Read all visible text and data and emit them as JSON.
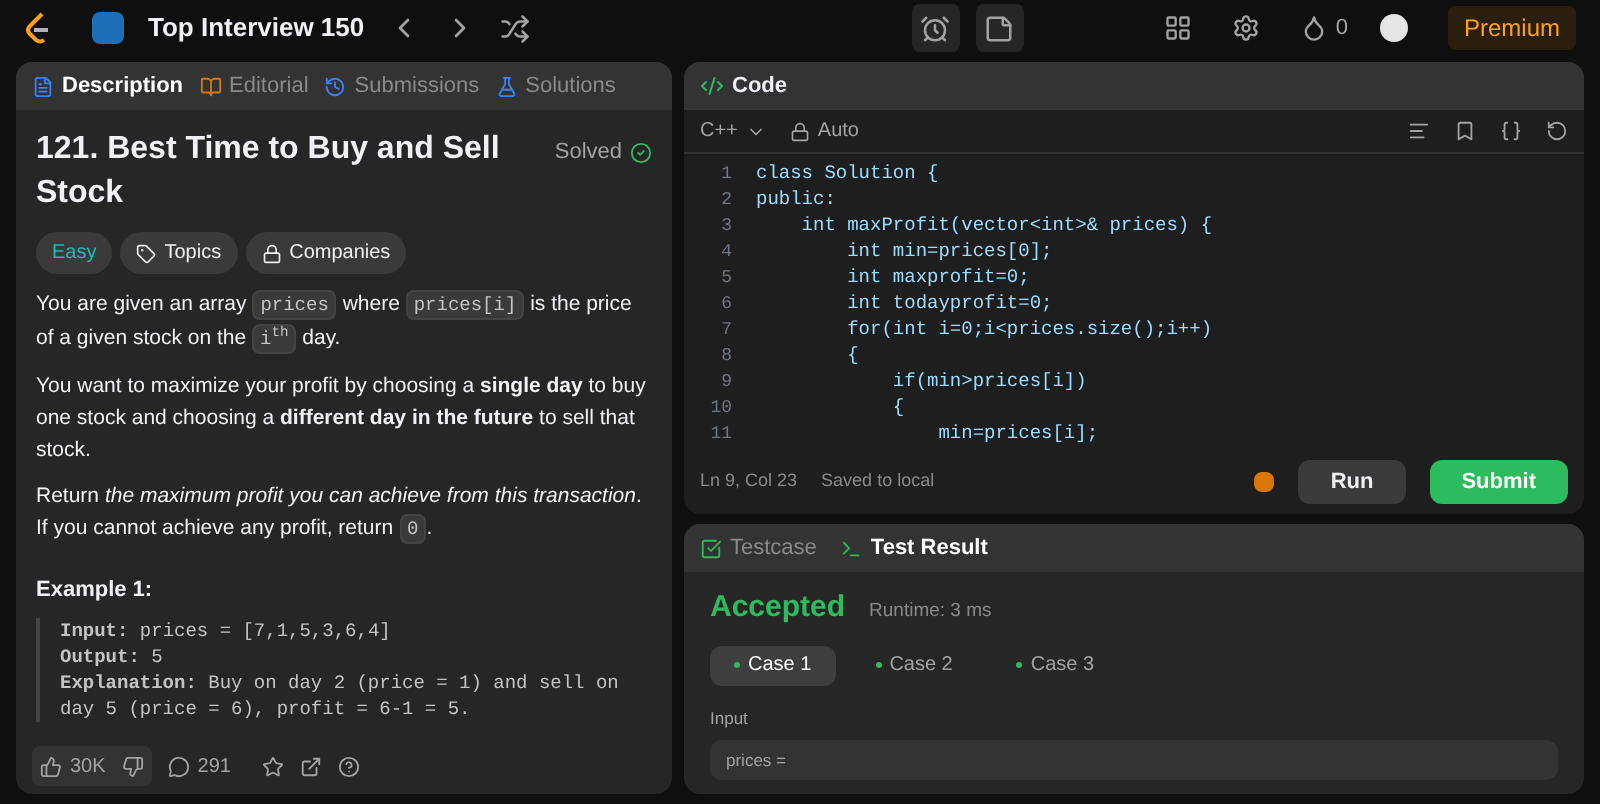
{
  "top_bar": {
    "list_title": "Top Interview 150",
    "streak": "0",
    "premium": "Premium"
  },
  "description_tabs": [
    {
      "label": "Description",
      "selected": true
    },
    {
      "label": "Editorial",
      "selected": false
    },
    {
      "label": "Submissions",
      "selected": false
    },
    {
      "label": "Solutions",
      "selected": false
    }
  ],
  "problem": {
    "title": "121. Best Time to Buy and Sell Stock",
    "status": "Solved",
    "difficulty": "Easy",
    "tags": [
      "Topics",
      "Companies"
    ],
    "paragraphs": [
      [
        {
          "kind": "text",
          "text": "You are given an array "
        },
        {
          "kind": "code",
          "text": "prices"
        },
        {
          "kind": "text",
          "text": " where "
        },
        {
          "kind": "code",
          "text": "prices[i]"
        },
        {
          "kind": "text",
          "text": " is the price of a given stock on the "
        },
        {
          "kind": "code",
          "text": "i$^{th}$"
        },
        {
          "kind": "text",
          "text": " day."
        }
      ],
      [
        {
          "kind": "text",
          "text": "You want to maximize your profit by choosing a **single day** to buy one stock and choosing a **different day in the future** to sell that stock."
        }
      ],
      [
        {
          "kind": "text",
          "text": "Return *the maximum profit you can achieve from this transaction*. If you cannot achieve any profit, return "
        },
        {
          "kind": "code",
          "text": "0"
        },
        {
          "kind": "text",
          "text": "."
        }
      ]
    ],
    "example_title": "Example 1:",
    "example_lines": [
      "**Input:** prices = [7,1,5,3,6,4]",
      "**Output:** 5",
      "**Explanation:** Buy on day 2 (price = 1) and sell on day 5 (price = 6), profit = 6-1 = 5."
    ]
  },
  "footer": {
    "likes": "30K",
    "comments": "291"
  },
  "code_panel": {
    "title": "Code",
    "language": "C++",
    "mode": "Auto",
    "lines": [
      {
        "number": "1",
        "text": "class Solution {"
      },
      {
        "number": "2",
        "text": "public:"
      },
      {
        "number": "3",
        "text": "    int maxProfit(vector<int>& prices) {"
      },
      {
        "number": "4",
        "text": "        int min=prices[0];"
      },
      {
        "number": "5",
        "text": "        int maxprofit=0;"
      },
      {
        "number": "6",
        "text": "        int todayprofit=0;"
      },
      {
        "number": "7",
        "text": "        for(int i=0;i<prices.size();i++)"
      },
      {
        "number": "8",
        "text": "        {"
      },
      {
        "number": "9",
        "text": "            if(min>prices[i])"
      },
      {
        "number": "10",
        "text": "            {"
      },
      {
        "number": "11",
        "text": "                min=prices[i];"
      }
    ],
    "cursor": "Ln 9, Col 23",
    "saved": "Saved to local",
    "run": "Run",
    "submit": "Submit"
  },
  "result_tabs": [
    {
      "label": "Testcase",
      "selected": false
    },
    {
      "label": "Test Result",
      "selected": true
    }
  ],
  "result": {
    "verdict": "Accepted",
    "runtime": "Runtime: 3 ms",
    "cases": [
      {
        "label": "Case 1",
        "selected": true
      },
      {
        "label": "Case 2",
        "selected": false
      },
      {
        "label": "Case 3",
        "selected": false
      }
    ],
    "input_label": "Input",
    "input_value": "prices ="
  }
}
